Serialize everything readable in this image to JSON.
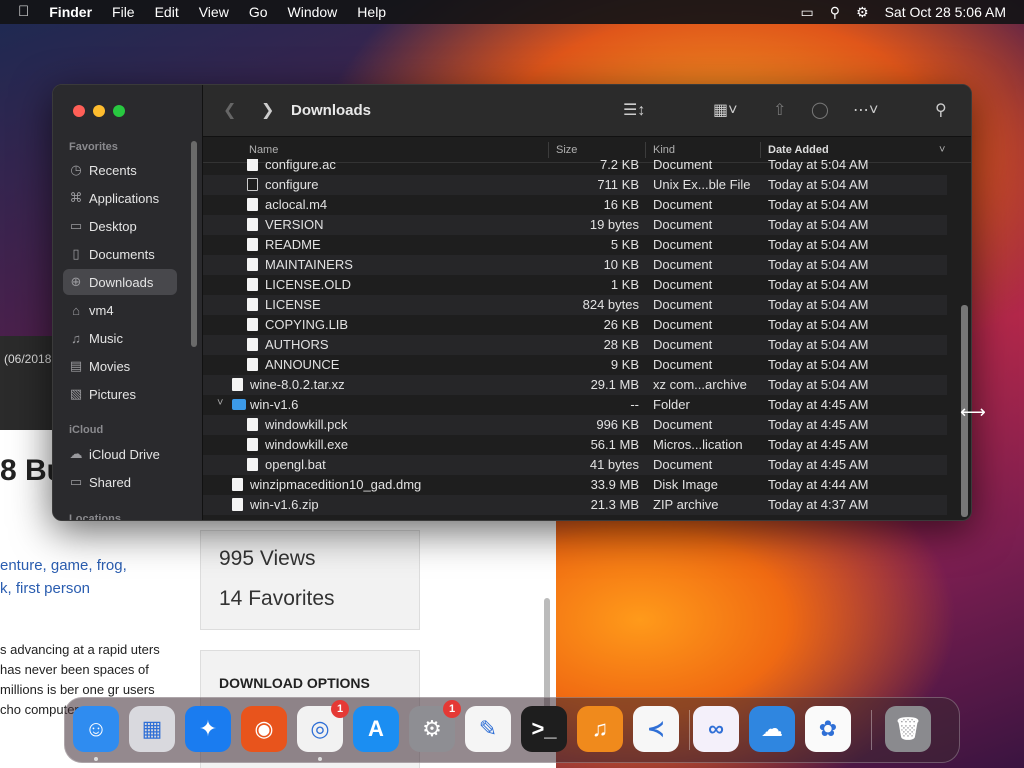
{
  "menubar": {
    "app": "Finder",
    "items": [
      "File",
      "Edit",
      "View",
      "Go",
      "Window",
      "Help"
    ],
    "clock": "Sat Oct 28  5:06 AM"
  },
  "background_page": {
    "dark_text": "(06/2018",
    "title": "8 Bu",
    "tags_line1": "enture, game, frog,",
    "tags_line2": "k, first person",
    "body": "s advancing at a rapid uters has never been spaces of millions is ber one gr users cho computer",
    "views": "995 Views",
    "favorites": "14 Favorites",
    "download_heading": "DOWNLOAD OPTIONS"
  },
  "finder": {
    "title": "Downloads",
    "sidebar": {
      "favorites_header": "Favorites",
      "favorites": [
        {
          "label": "Recents",
          "icon": "clock-icon"
        },
        {
          "label": "Applications",
          "icon": "applications-icon"
        },
        {
          "label": "Desktop",
          "icon": "desktop-icon"
        },
        {
          "label": "Documents",
          "icon": "document-icon"
        },
        {
          "label": "Downloads",
          "icon": "download-icon",
          "selected": true
        },
        {
          "label": "vm4",
          "icon": "user-icon"
        },
        {
          "label": "Music",
          "icon": "music-icon"
        },
        {
          "label": "Movies",
          "icon": "film-icon"
        },
        {
          "label": "Pictures",
          "icon": "photo-icon"
        }
      ],
      "icloud_header": "iCloud",
      "icloud": [
        {
          "label": "iCloud Drive",
          "icon": "cloud-icon"
        },
        {
          "label": "Shared",
          "icon": "shared-folder-icon"
        }
      ],
      "locations_header": "Locations"
    },
    "columns": {
      "name": "Name",
      "size": "Size",
      "kind": "Kind",
      "date": "Date Added"
    },
    "rows": [
      {
        "name": "configure.ac",
        "size": "7.2 KB",
        "kind": "Document",
        "date": "Today at 5:04 AM",
        "indent": 1,
        "icon": "doc"
      },
      {
        "name": "configure",
        "size": "711 KB",
        "kind": "Unix Ex...ble File",
        "date": "Today at 5:04 AM",
        "indent": 1,
        "icon": "exec"
      },
      {
        "name": "aclocal.m4",
        "size": "16 KB",
        "kind": "Document",
        "date": "Today at 5:04 AM",
        "indent": 1,
        "icon": "doc"
      },
      {
        "name": "VERSION",
        "size": "19 bytes",
        "kind": "Document",
        "date": "Today at 5:04 AM",
        "indent": 1,
        "icon": "doc"
      },
      {
        "name": "README",
        "size": "5 KB",
        "kind": "Document",
        "date": "Today at 5:04 AM",
        "indent": 1,
        "icon": "doc"
      },
      {
        "name": "MAINTAINERS",
        "size": "10 KB",
        "kind": "Document",
        "date": "Today at 5:04 AM",
        "indent": 1,
        "icon": "doc"
      },
      {
        "name": "LICENSE.OLD",
        "size": "1 KB",
        "kind": "Document",
        "date": "Today at 5:04 AM",
        "indent": 1,
        "icon": "doc"
      },
      {
        "name": "LICENSE",
        "size": "824 bytes",
        "kind": "Document",
        "date": "Today at 5:04 AM",
        "indent": 1,
        "icon": "doc"
      },
      {
        "name": "COPYING.LIB",
        "size": "26 KB",
        "kind": "Document",
        "date": "Today at 5:04 AM",
        "indent": 1,
        "icon": "doc"
      },
      {
        "name": "AUTHORS",
        "size": "28 KB",
        "kind": "Document",
        "date": "Today at 5:04 AM",
        "indent": 1,
        "icon": "doc"
      },
      {
        "name": "ANNOUNCE",
        "size": "9 KB",
        "kind": "Document",
        "date": "Today at 5:04 AM",
        "indent": 1,
        "icon": "doc"
      },
      {
        "name": "wine-8.0.2.tar.xz",
        "size": "29.1 MB",
        "kind": "xz com...archive",
        "date": "Today at 5:04 AM",
        "indent": 0,
        "icon": "doc"
      },
      {
        "name": "win-v1.6",
        "size": "--",
        "kind": "Folder",
        "date": "Today at 4:45 AM",
        "indent": 0,
        "icon": "folder",
        "expanded": true
      },
      {
        "name": "windowkill.pck",
        "size": "996 KB",
        "kind": "Document",
        "date": "Today at 4:45 AM",
        "indent": 1,
        "icon": "doc"
      },
      {
        "name": "windowkill.exe",
        "size": "56.1 MB",
        "kind": "Micros...lication",
        "date": "Today at 4:45 AM",
        "indent": 1,
        "icon": "doc"
      },
      {
        "name": "opengl.bat",
        "size": "41 bytes",
        "kind": "Document",
        "date": "Today at 4:45 AM",
        "indent": 1,
        "icon": "doc"
      },
      {
        "name": "winzipmacedition10_gad.dmg",
        "size": "33.9 MB",
        "kind": "Disk Image",
        "date": "Today at 4:44 AM",
        "indent": 0,
        "icon": "doc"
      },
      {
        "name": "win-v1.6.zip",
        "size": "21.3 MB",
        "kind": "ZIP archive",
        "date": "Today at 4:37 AM",
        "indent": 0,
        "icon": "doc"
      }
    ]
  },
  "dock": [
    {
      "name": "finder",
      "color": "#2f8cf0",
      "glyph": "☺"
    },
    {
      "name": "launchpad",
      "color": "#d9d9de",
      "glyph": "▦"
    },
    {
      "name": "safari",
      "color": "#1a7cf0",
      "glyph": "✦"
    },
    {
      "name": "firefox",
      "color": "#e8541c",
      "glyph": "◉"
    },
    {
      "name": "chrome",
      "color": "#f2f2f2",
      "glyph": "◎",
      "badge": "1"
    },
    {
      "name": "app-store",
      "color": "#1b8ef2",
      "glyph": "A"
    },
    {
      "name": "system-settings",
      "color": "#8e8e93",
      "glyph": "⚙",
      "badge": "1"
    },
    {
      "name": "textedit",
      "color": "#f5f5f5",
      "glyph": "✎"
    },
    {
      "name": "terminal",
      "color": "#1e1e1e",
      "glyph": ">_"
    },
    {
      "name": "garageband",
      "color": "#f08a1c",
      "glyph": "♫"
    },
    {
      "name": "vscode",
      "color": "#f7f7f7",
      "glyph": "≺"
    },
    {
      "name": "visual-studio",
      "color": "#f4f0fa",
      "glyph": "∞"
    },
    {
      "name": "weather",
      "color": "#2f86e0",
      "glyph": "☁"
    },
    {
      "name": "photos",
      "color": "#fafafa",
      "glyph": "✿"
    },
    {
      "name": "trash",
      "color": "#8a8a8e",
      "glyph": "🗑"
    }
  ]
}
